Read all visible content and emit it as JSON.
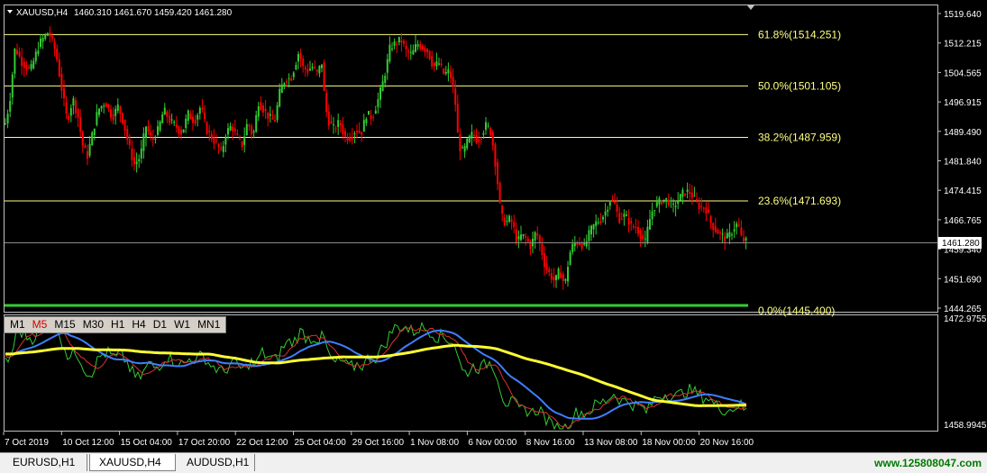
{
  "header": {
    "symbol_info": "XAUUSD,H4",
    "ohlc": "1460.310 1461.670 1459.420 1461.280"
  },
  "price_axis": {
    "labels": [
      "1519.640",
      "1512.215",
      "1504.565",
      "1496.915",
      "1489.490",
      "1481.840",
      "1474.415",
      "1466.765",
      "1459.340",
      "1451.690",
      "1444.265"
    ],
    "current_price": "1461.280"
  },
  "fib_levels": [
    {
      "label": "61.8%(1514.251)",
      "price": 1514.251
    },
    {
      "label": "50.0%(1501.105)",
      "price": 1501.105
    },
    {
      "label": "38.2%(1487.959)",
      "price": 1487.959
    },
    {
      "label": "23.6%(1471.693)",
      "price": 1471.693
    },
    {
      "label": "0.0%(1445.400)",
      "price": 1445.4
    }
  ],
  "sub_axis": {
    "labels": [
      "1472.9755",
      "1458.9945"
    ]
  },
  "time_axis": {
    "labels": [
      "7 Oct 2019",
      "10 Oct 12:00",
      "15 Oct 04:00",
      "17 Oct 20:00",
      "22 Oct 12:00",
      "25 Oct 04:00",
      "29 Oct 16:00",
      "1 Nov 08:00",
      "6 Nov 00:00",
      "8 Nov 16:00",
      "13 Nov 08:00",
      "18 Nov 00:00",
      "20 Nov 16:00"
    ]
  },
  "timeframes": {
    "items": [
      "M1",
      "M5",
      "M15",
      "M30",
      "H1",
      "H4",
      "D1",
      "W1",
      "MN1"
    ],
    "active": "M5"
  },
  "tabs": {
    "items": [
      "EURUSD,H1",
      "XAUUSD,H4",
      "AUDUSD,H1"
    ],
    "active": "XAUUSD,H4"
  },
  "watermark": "www.125808047.com",
  "colors": {
    "up": "#32cd32",
    "down": "#ff0000",
    "fib": "#ffff80",
    "grid": "#c0c0c0",
    "ma_yellow": "#ffff33",
    "ma_blue": "#3f7fff",
    "ma_red": "#e03030",
    "ma_green": "#33cc33"
  },
  "chart_data": {
    "type": "candlestick",
    "symbol": "XAUUSD",
    "timeframe": "H4",
    "ylim": [
      1444.265,
      1519.64
    ],
    "path_anchors": [
      [
        0,
        1496
      ],
      [
        6,
        1490
      ],
      [
        12,
        1497
      ],
      [
        18,
        1511
      ],
      [
        26,
        1507
      ],
      [
        35,
        1505
      ],
      [
        45,
        1512
      ],
      [
        55,
        1515
      ],
      [
        63,
        1510
      ],
      [
        70,
        1500
      ],
      [
        76,
        1492
      ],
      [
        82,
        1498
      ],
      [
        88,
        1493
      ],
      [
        93,
        1486
      ],
      [
        98,
        1483
      ],
      [
        104,
        1489
      ],
      [
        110,
        1495
      ],
      [
        118,
        1497
      ],
      [
        126,
        1493
      ],
      [
        132,
        1496
      ],
      [
        138,
        1492
      ],
      [
        144,
        1486
      ],
      [
        150,
        1481
      ],
      [
        157,
        1483
      ],
      [
        163,
        1491
      ],
      [
        170,
        1487
      ],
      [
        177,
        1490
      ],
      [
        183,
        1495
      ],
      [
        190,
        1492
      ],
      [
        196,
        1491
      ],
      [
        203,
        1489
      ],
      [
        210,
        1494
      ],
      [
        217,
        1492
      ],
      [
        224,
        1496
      ],
      [
        230,
        1490
      ],
      [
        236,
        1488
      ],
      [
        242,
        1486
      ],
      [
        247,
        1484
      ],
      [
        252,
        1489
      ],
      [
        258,
        1491
      ],
      [
        264,
        1488
      ],
      [
        270,
        1486
      ],
      [
        276,
        1492
      ],
      [
        282,
        1488
      ],
      [
        288,
        1497
      ],
      [
        294,
        1495
      ],
      [
        300,
        1493
      ],
      [
        306,
        1492
      ],
      [
        312,
        1500
      ],
      [
        318,
        1503
      ],
      [
        324,
        1503
      ],
      [
        328,
        1506
      ],
      [
        333,
        1510
      ],
      [
        337,
        1506
      ],
      [
        342,
        1505
      ],
      [
        348,
        1506
      ],
      [
        354,
        1504
      ],
      [
        358,
        1508
      ],
      [
        362,
        1496
      ],
      [
        366,
        1492
      ],
      [
        372,
        1490
      ],
      [
        378,
        1492
      ],
      [
        384,
        1488
      ],
      [
        390,
        1488
      ],
      [
        396,
        1490
      ],
      [
        402,
        1489
      ],
      [
        408,
        1494
      ],
      [
        414,
        1493
      ],
      [
        420,
        1497
      ],
      [
        426,
        1502
      ],
      [
        430,
        1506
      ],
      [
        434,
        1511
      ],
      [
        440,
        1512
      ],
      [
        446,
        1513
      ],
      [
        452,
        1510
      ],
      [
        458,
        1509
      ],
      [
        464,
        1512
      ],
      [
        470,
        1511
      ],
      [
        476,
        1510
      ],
      [
        482,
        1506
      ],
      [
        488,
        1507
      ],
      [
        494,
        1504
      ],
      [
        500,
        1505
      ],
      [
        506,
        1498
      ],
      [
        510,
        1486
      ],
      [
        515,
        1484
      ],
      [
        520,
        1487
      ],
      [
        526,
        1489
      ],
      [
        531,
        1487
      ],
      [
        536,
        1489
      ],
      [
        540,
        1491
      ],
      [
        545,
        1490
      ],
      [
        549,
        1485
      ],
      [
        553,
        1477
      ],
      [
        557,
        1468
      ],
      [
        562,
        1466
      ],
      [
        566,
        1467
      ],
      [
        570,
        1466
      ],
      [
        575,
        1461
      ],
      [
        580,
        1463
      ],
      [
        585,
        1462
      ],
      [
        590,
        1460
      ],
      [
        596,
        1464
      ],
      [
        601,
        1460
      ],
      [
        606,
        1455
      ],
      [
        611,
        1453
      ],
      [
        617,
        1451
      ],
      [
        622,
        1454
      ],
      [
        628,
        1450
      ],
      [
        633,
        1458
      ],
      [
        638,
        1461
      ],
      [
        644,
        1461
      ],
      [
        650,
        1460
      ],
      [
        656,
        1464
      ],
      [
        662,
        1466
      ],
      [
        668,
        1467
      ],
      [
        673,
        1469
      ],
      [
        678,
        1472
      ],
      [
        683,
        1471
      ],
      [
        688,
        1467
      ],
      [
        693,
        1468
      ],
      [
        698,
        1467
      ],
      [
        702,
        1465
      ],
      [
        707,
        1465
      ],
      [
        712,
        1463
      ],
      [
        717,
        1461
      ],
      [
        721,
        1466
      ],
      [
        726,
        1470
      ],
      [
        731,
        1471
      ],
      [
        736,
        1472
      ],
      [
        742,
        1472
      ],
      [
        748,
        1470
      ],
      [
        754,
        1472
      ],
      [
        760,
        1474
      ],
      [
        766,
        1474
      ],
      [
        772,
        1472
      ],
      [
        778,
        1470
      ],
      [
        784,
        1470
      ],
      [
        790,
        1466
      ],
      [
        796,
        1464
      ],
      [
        801,
        1463
      ],
      [
        806,
        1462
      ],
      [
        811,
        1463
      ],
      [
        816,
        1465
      ],
      [
        820,
        1466
      ],
      [
        824,
        1462
      ],
      [
        828,
        1461.28
      ]
    ]
  }
}
